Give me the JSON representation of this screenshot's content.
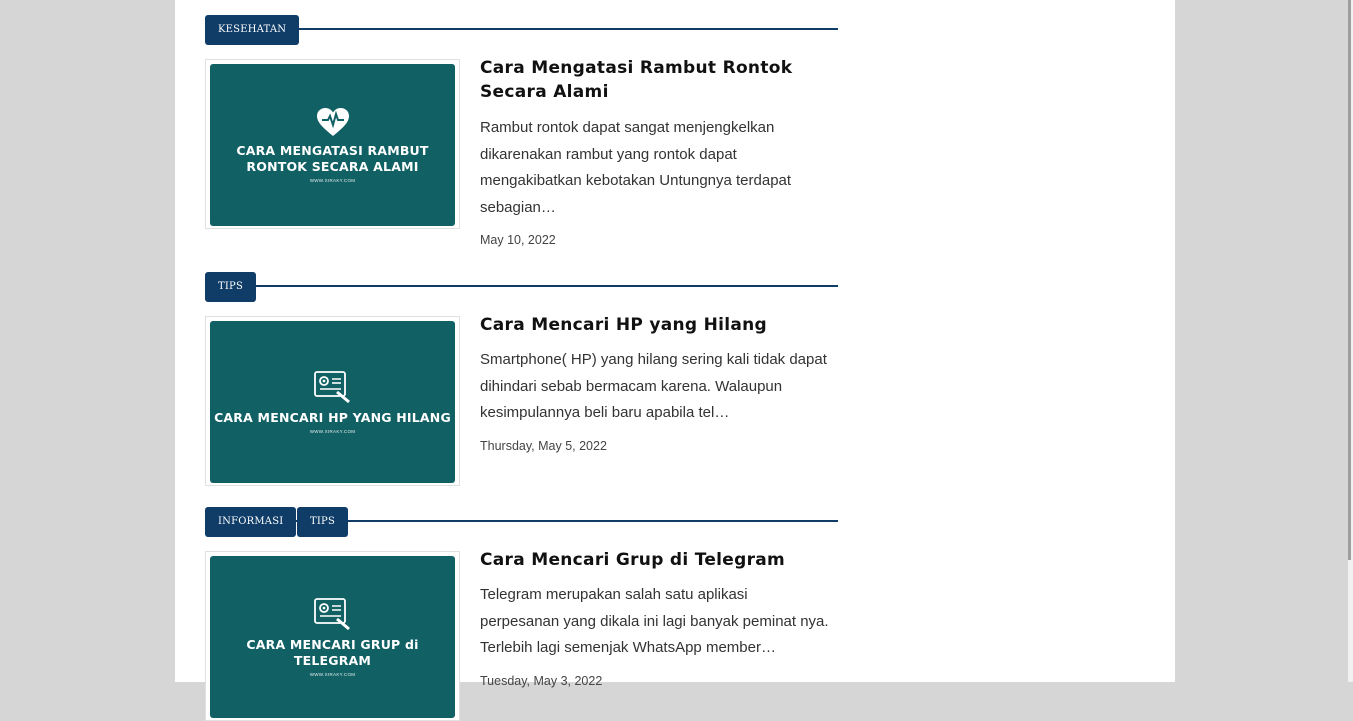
{
  "posts": [
    {
      "labels": [
        "KESEHATAN"
      ],
      "thumb_title": "CARA MENGATASI RAMBUT\nRONTOK SECARA ALAMI",
      "thumb_site": "WWW.XIRAKY.COM",
      "thumb_icon": "heart-pulse-icon",
      "title": "Cara Mengatasi Rambut Rontok Secara Alami",
      "excerpt": "Rambut rontok dapat sangat menjengkelkan dikarenakan rambut yang rontok dapat mengakibatkan kebotakan Untungnya terdapat sebagian…",
      "date": "May 10, 2022"
    },
    {
      "labels": [
        "TIPS"
      ],
      "thumb_title": "CARA MENCARI HP YANG HILANG",
      "thumb_site": "WWW.XIRAKY.COM",
      "thumb_icon": "settings-document-icon",
      "title": "Cara Mencari HP yang Hilang",
      "excerpt": "Smartphone( HP) yang hilang sering kali tidak dapat dihindari sebab bermacam karena. Walaupun kesimpulannya beli baru apabila tel…",
      "date": "Thursday, May 5, 2022"
    },
    {
      "labels": [
        "INFORMASI",
        "TIPS"
      ],
      "thumb_title": "CARA MENCARI GRUP di\nTELEGRAM",
      "thumb_site": "WWW.XIRAKY.COM",
      "thumb_icon": "settings-document-icon",
      "title": "Cara Mencari Grup di Telegram",
      "excerpt": "Telegram merupakan salah satu aplikasi perpesanan yang dikala ini lagi banyak peminat nya. Terlebih lagi semenjak WhatsApp member…",
      "date": "Tuesday, May 3, 2022"
    }
  ],
  "colors": {
    "label_bg": "#0f3d68",
    "thumb_bg": "#106064",
    "page_bg": "#d6d6d6"
  }
}
